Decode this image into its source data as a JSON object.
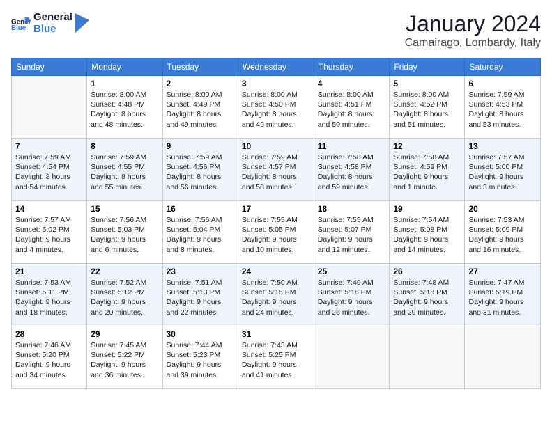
{
  "header": {
    "logo_line1": "General",
    "logo_line2": "Blue",
    "month": "January 2024",
    "location": "Camairago, Lombardy, Italy"
  },
  "weekdays": [
    "Sunday",
    "Monday",
    "Tuesday",
    "Wednesday",
    "Thursday",
    "Friday",
    "Saturday"
  ],
  "weeks": [
    [
      {
        "day": "",
        "info": ""
      },
      {
        "day": "1",
        "info": "Sunrise: 8:00 AM\nSunset: 4:48 PM\nDaylight: 8 hours\nand 48 minutes."
      },
      {
        "day": "2",
        "info": "Sunrise: 8:00 AM\nSunset: 4:49 PM\nDaylight: 8 hours\nand 49 minutes."
      },
      {
        "day": "3",
        "info": "Sunrise: 8:00 AM\nSunset: 4:50 PM\nDaylight: 8 hours\nand 49 minutes."
      },
      {
        "day": "4",
        "info": "Sunrise: 8:00 AM\nSunset: 4:51 PM\nDaylight: 8 hours\nand 50 minutes."
      },
      {
        "day": "5",
        "info": "Sunrise: 8:00 AM\nSunset: 4:52 PM\nDaylight: 8 hours\nand 51 minutes."
      },
      {
        "day": "6",
        "info": "Sunrise: 7:59 AM\nSunset: 4:53 PM\nDaylight: 8 hours\nand 53 minutes."
      }
    ],
    [
      {
        "day": "7",
        "info": "Sunrise: 7:59 AM\nSunset: 4:54 PM\nDaylight: 8 hours\nand 54 minutes."
      },
      {
        "day": "8",
        "info": "Sunrise: 7:59 AM\nSunset: 4:55 PM\nDaylight: 8 hours\nand 55 minutes."
      },
      {
        "day": "9",
        "info": "Sunrise: 7:59 AM\nSunset: 4:56 PM\nDaylight: 8 hours\nand 56 minutes."
      },
      {
        "day": "10",
        "info": "Sunrise: 7:59 AM\nSunset: 4:57 PM\nDaylight: 8 hours\nand 58 minutes."
      },
      {
        "day": "11",
        "info": "Sunrise: 7:58 AM\nSunset: 4:58 PM\nDaylight: 8 hours\nand 59 minutes."
      },
      {
        "day": "12",
        "info": "Sunrise: 7:58 AM\nSunset: 4:59 PM\nDaylight: 9 hours\nand 1 minute."
      },
      {
        "day": "13",
        "info": "Sunrise: 7:57 AM\nSunset: 5:00 PM\nDaylight: 9 hours\nand 3 minutes."
      }
    ],
    [
      {
        "day": "14",
        "info": "Sunrise: 7:57 AM\nSunset: 5:02 PM\nDaylight: 9 hours\nand 4 minutes."
      },
      {
        "day": "15",
        "info": "Sunrise: 7:56 AM\nSunset: 5:03 PM\nDaylight: 9 hours\nand 6 minutes."
      },
      {
        "day": "16",
        "info": "Sunrise: 7:56 AM\nSunset: 5:04 PM\nDaylight: 9 hours\nand 8 minutes."
      },
      {
        "day": "17",
        "info": "Sunrise: 7:55 AM\nSunset: 5:05 PM\nDaylight: 9 hours\nand 10 minutes."
      },
      {
        "day": "18",
        "info": "Sunrise: 7:55 AM\nSunset: 5:07 PM\nDaylight: 9 hours\nand 12 minutes."
      },
      {
        "day": "19",
        "info": "Sunrise: 7:54 AM\nSunset: 5:08 PM\nDaylight: 9 hours\nand 14 minutes."
      },
      {
        "day": "20",
        "info": "Sunrise: 7:53 AM\nSunset: 5:09 PM\nDaylight: 9 hours\nand 16 minutes."
      }
    ],
    [
      {
        "day": "21",
        "info": "Sunrise: 7:53 AM\nSunset: 5:11 PM\nDaylight: 9 hours\nand 18 minutes."
      },
      {
        "day": "22",
        "info": "Sunrise: 7:52 AM\nSunset: 5:12 PM\nDaylight: 9 hours\nand 20 minutes."
      },
      {
        "day": "23",
        "info": "Sunrise: 7:51 AM\nSunset: 5:13 PM\nDaylight: 9 hours\nand 22 minutes."
      },
      {
        "day": "24",
        "info": "Sunrise: 7:50 AM\nSunset: 5:15 PM\nDaylight: 9 hours\nand 24 minutes."
      },
      {
        "day": "25",
        "info": "Sunrise: 7:49 AM\nSunset: 5:16 PM\nDaylight: 9 hours\nand 26 minutes."
      },
      {
        "day": "26",
        "info": "Sunrise: 7:48 AM\nSunset: 5:18 PM\nDaylight: 9 hours\nand 29 minutes."
      },
      {
        "day": "27",
        "info": "Sunrise: 7:47 AM\nSunset: 5:19 PM\nDaylight: 9 hours\nand 31 minutes."
      }
    ],
    [
      {
        "day": "28",
        "info": "Sunrise: 7:46 AM\nSunset: 5:20 PM\nDaylight: 9 hours\nand 34 minutes."
      },
      {
        "day": "29",
        "info": "Sunrise: 7:45 AM\nSunset: 5:22 PM\nDaylight: 9 hours\nand 36 minutes."
      },
      {
        "day": "30",
        "info": "Sunrise: 7:44 AM\nSunset: 5:23 PM\nDaylight: 9 hours\nand 39 minutes."
      },
      {
        "day": "31",
        "info": "Sunrise: 7:43 AM\nSunset: 5:25 PM\nDaylight: 9 hours\nand 41 minutes."
      },
      {
        "day": "",
        "info": ""
      },
      {
        "day": "",
        "info": ""
      },
      {
        "day": "",
        "info": ""
      }
    ]
  ]
}
